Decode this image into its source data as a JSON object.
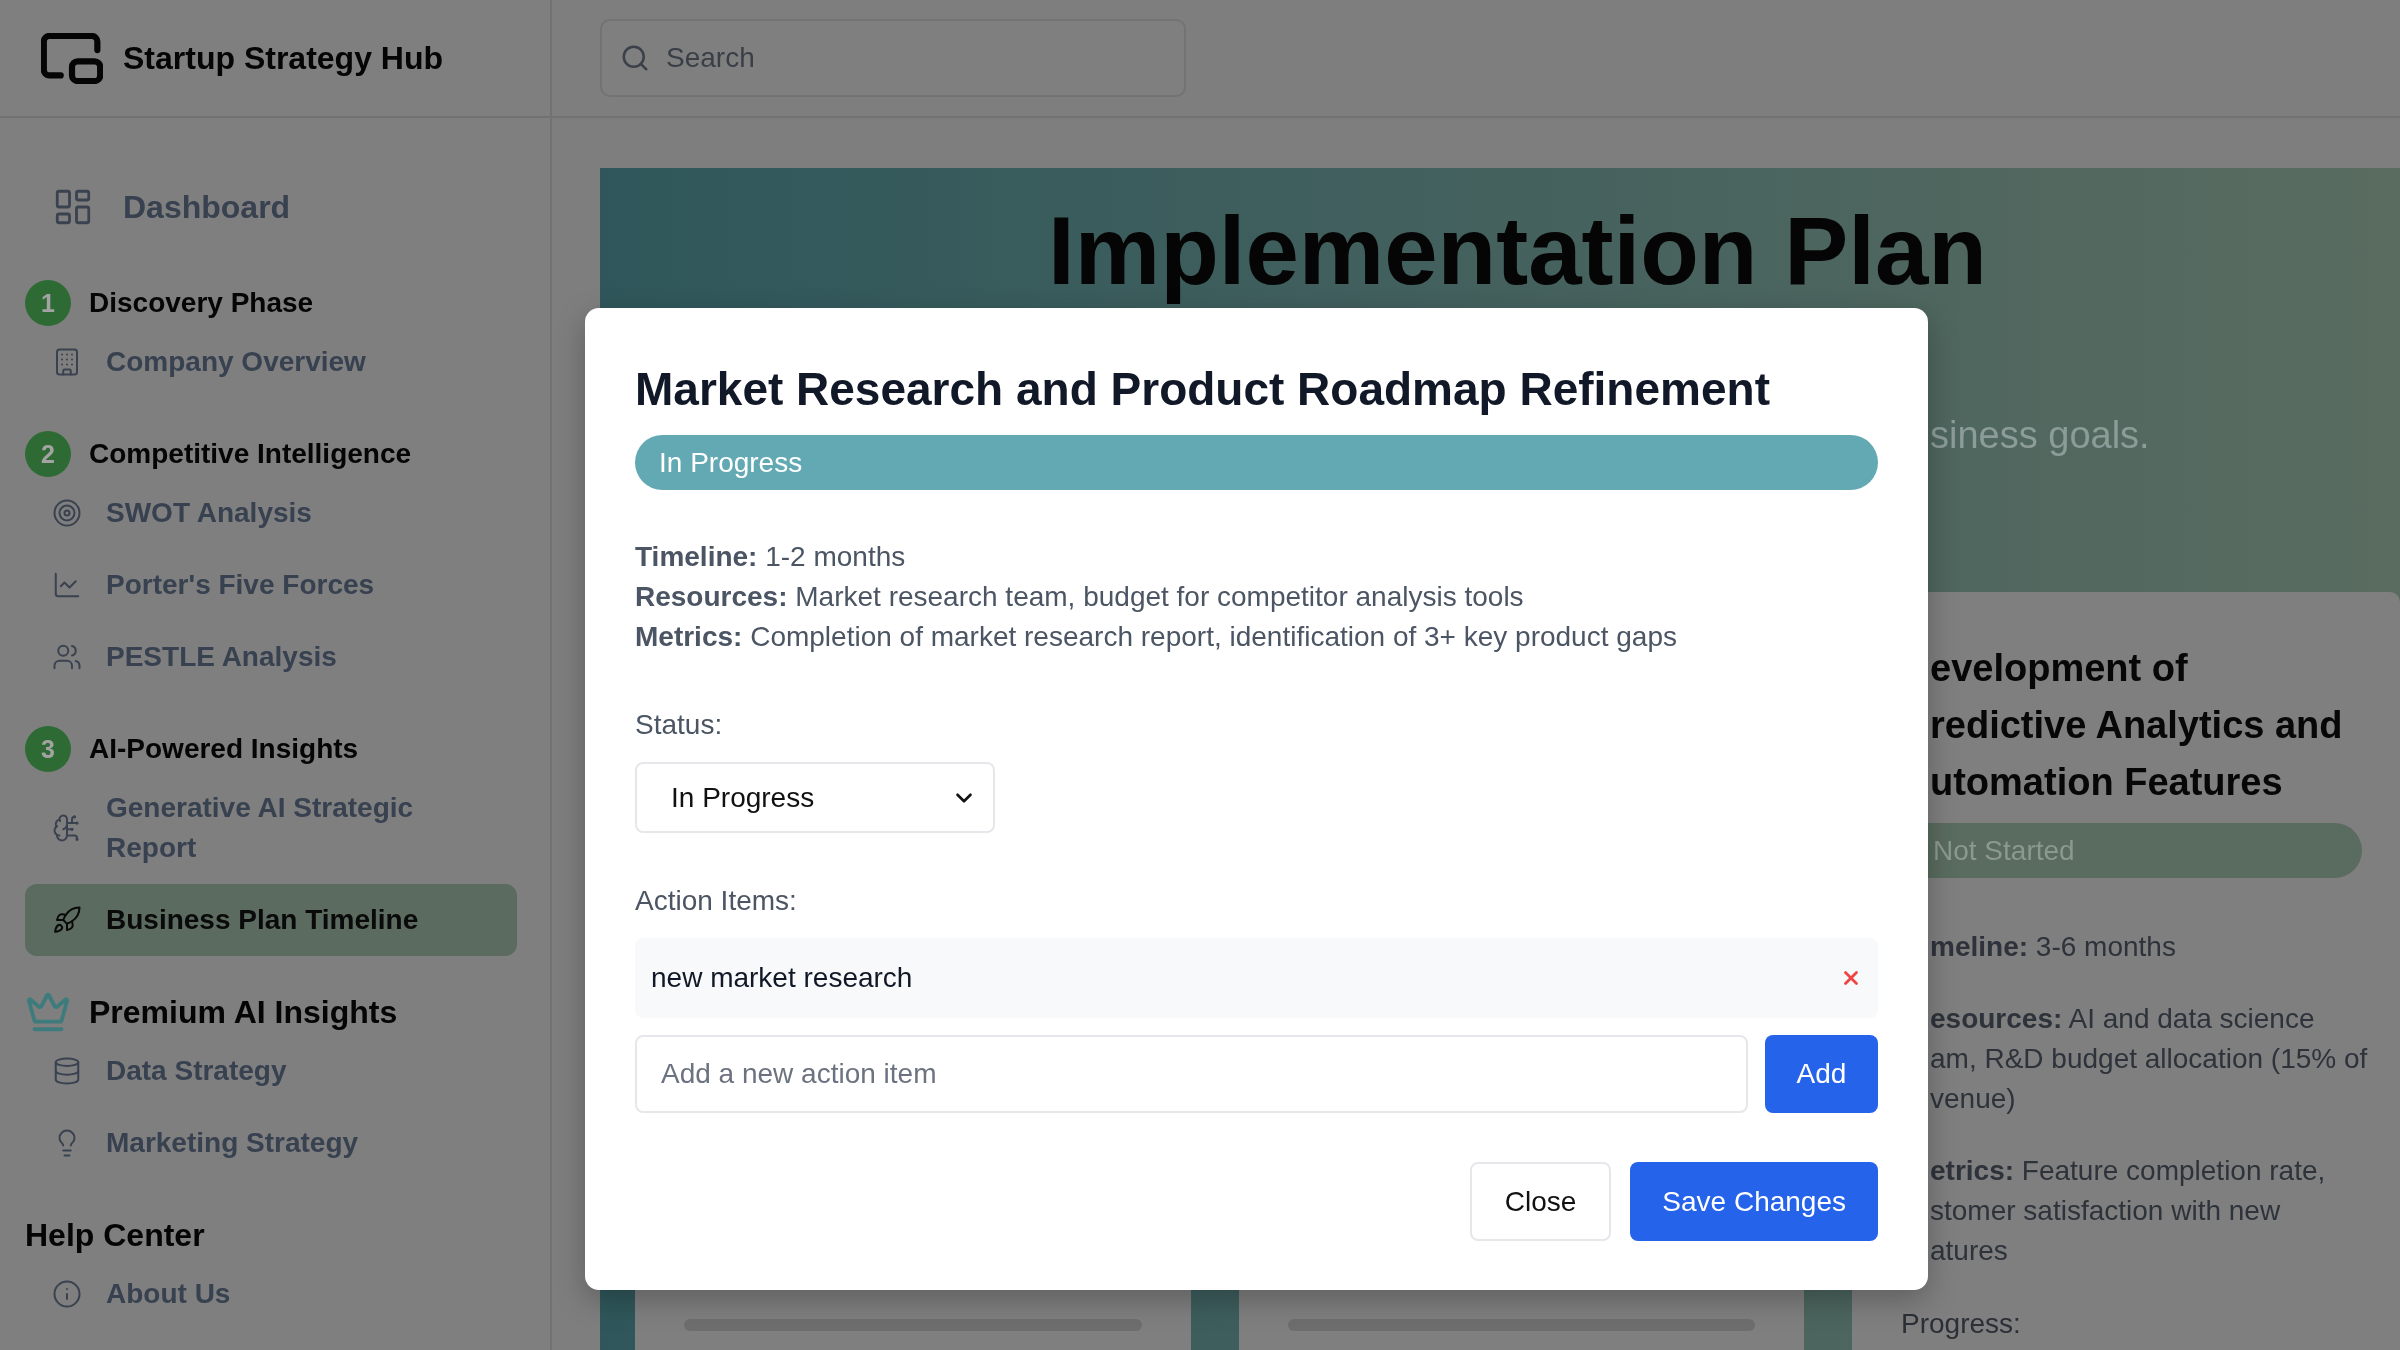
{
  "sidebar": {
    "brand": "Startup Strategy Hub",
    "dashboard": {
      "label": "Dashboard",
      "selected": false
    },
    "groups": [
      {
        "kind": "phase",
        "number": "1",
        "label": "Discovery Phase",
        "items": [
          {
            "label": "Company Overview",
            "selected": false
          }
        ]
      },
      {
        "kind": "phase",
        "number": "2",
        "label": "Competitive Intelligence",
        "items": [
          {
            "label": "SWOT Analysis",
            "selected": false
          },
          {
            "label": "Porter's Five Forces",
            "selected": false
          },
          {
            "label": "PESTLE Analysis",
            "selected": false
          }
        ]
      },
      {
        "kind": "phase",
        "number": "3",
        "label": "AI-Powered Insights",
        "items": [
          {
            "label": "Generative AI Strategic Report",
            "selected": false
          },
          {
            "label": "Business Plan Timeline",
            "selected": true
          }
        ]
      },
      {
        "kind": "premium",
        "label": "Premium AI Insights",
        "items": [
          {
            "label": "Data Strategy",
            "selected": false
          },
          {
            "label": "Marketing Strategy",
            "selected": false
          }
        ]
      },
      {
        "kind": "plain",
        "label": "Help Center",
        "items": [
          {
            "label": "About Us",
            "selected": false
          }
        ]
      }
    ]
  },
  "topbar": {
    "search": {
      "placeholder": "Search"
    }
  },
  "page": {
    "title": "Implementation Plan",
    "subtitle": "siness goals.",
    "cards": [
      {
        "kind": "progress",
        "progress": {
          "level": 0
        }
      },
      {
        "kind": "progress",
        "progress": {
          "level": 0
        }
      },
      {
        "kind": "summary",
        "title": "evelopment of\nredictive Analytics and\nutomation Features",
        "status": "Not Started",
        "details": [
          "**meline:** 3-6 months",
          "**esources:** AI and data science\nam, R&D budget allocation (15% of\nvenue)",
          "**etrics:** Feature completion rate,\nstomer satisfaction with new\natures"
        ],
        "progress_label": "Progress:"
      }
    ]
  },
  "modal": {
    "title": "Market Research and Product Roadmap Refinement",
    "status_badge": "In Progress",
    "details": [
      "**Timeline:** 1-2 months",
      "**Resources:** Market research team, budget for competitor analysis tools",
      "**Metrics:** Completion of market research report, identification of 3+ key product gaps"
    ],
    "status_label": "Status:",
    "status_select": {
      "value": "In Progress"
    },
    "action_items_label": "Action Items:",
    "action_items": [
      {
        "text": "new market research"
      }
    ],
    "new_item": {
      "placeholder": "Add a new action item"
    },
    "add_button": "Add",
    "buttons": [
      {
        "kind": "secondary",
        "label": "Close"
      },
      {
        "kind": "primary",
        "label": "Save Changes"
      }
    ]
  }
}
